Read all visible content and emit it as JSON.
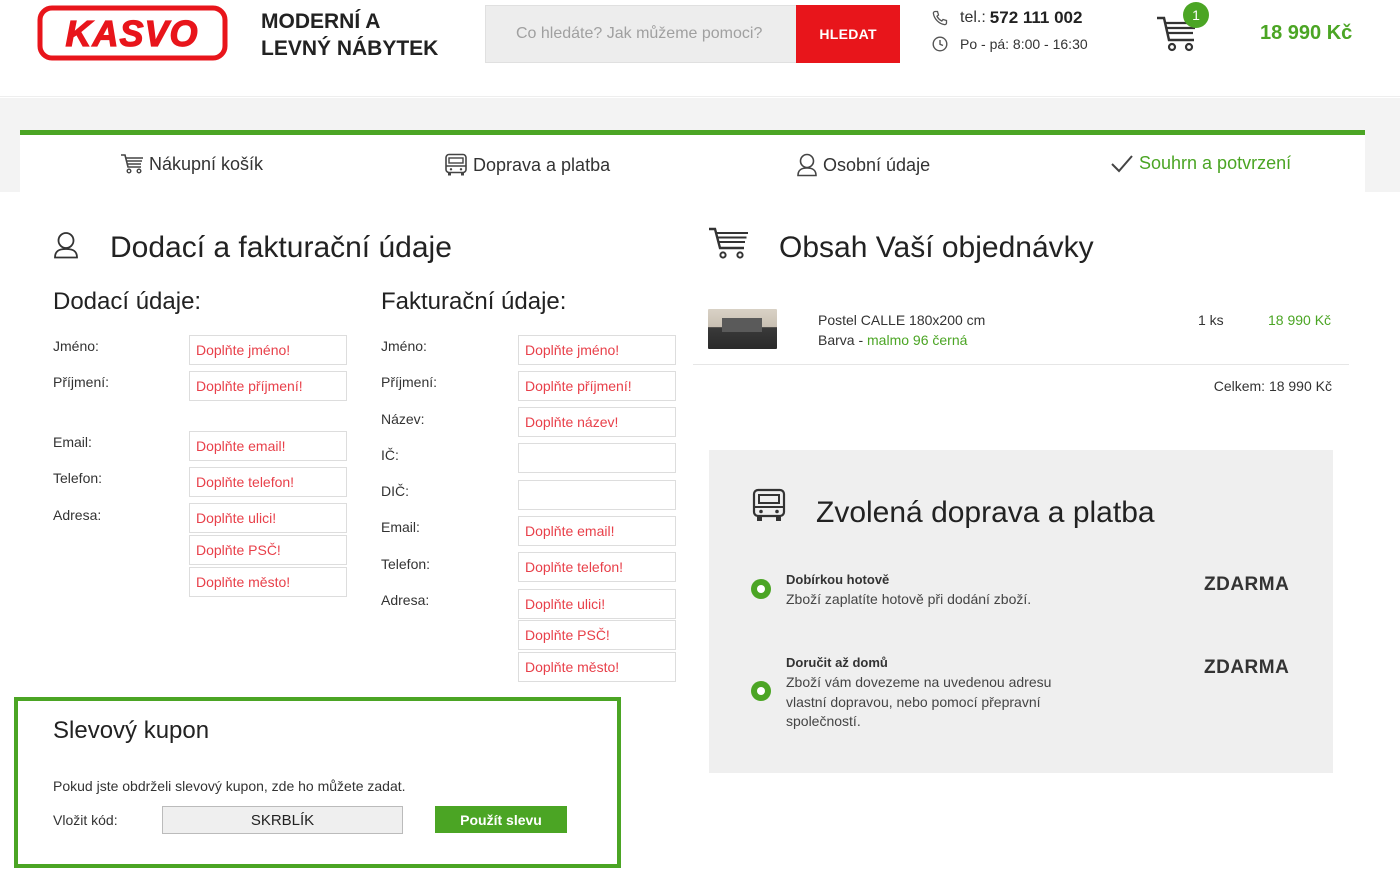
{
  "header": {
    "logo_text": "KASVO",
    "tagline_line1": "MODERNÍ A",
    "tagline_line2": "LEVNÝ NÁBYTEK",
    "search_placeholder": "Co hledáte? Jak můžeme pomoci?",
    "search_button": "HLEDAT",
    "phone_label": "tel.:",
    "phone_number": "572 111 002",
    "hours": "Po - pá: 8:00 - 16:30",
    "cart_count": "1",
    "cart_total": "18 990 Kč"
  },
  "steps": [
    {
      "label": "Nákupní košík",
      "icon": "cart-icon",
      "active": false
    },
    {
      "label": "Doprava a platba",
      "icon": "truck-icon",
      "active": false
    },
    {
      "label": "Osobní údaje",
      "icon": "user-icon",
      "active": false
    },
    {
      "label": "Souhrn a potvrzení",
      "icon": "check-icon",
      "active": true
    }
  ],
  "left_section": {
    "title": "Dodací a fakturační údaje",
    "delivery": {
      "title": "Dodací údaje:",
      "labels": {
        "name": "Jméno:",
        "surname": "Příjmení:",
        "email": "Email:",
        "phone": "Telefon:",
        "address": "Adresa:"
      },
      "placeholders": {
        "name": "Doplňte jméno!",
        "surname": "Doplňte příjmení!",
        "email": "Doplňte email!",
        "phone": "Doplňte telefon!",
        "street": "Doplňte ulici!",
        "zip": "Doplňte PSČ!",
        "city": "Doplňte město!"
      }
    },
    "billing": {
      "title": "Fakturační údaje:",
      "labels": {
        "name": "Jméno:",
        "surname": "Příjmení:",
        "company": "Název:",
        "ico": "IČ:",
        "dic": "DIČ:",
        "email": "Email:",
        "phone": "Telefon:",
        "address": "Adresa:"
      },
      "placeholders": {
        "name": "Doplňte jméno!",
        "surname": "Doplňte příjmení!",
        "company": "Doplňte název!",
        "ico": "",
        "dic": "",
        "email": "Doplňte email!",
        "phone": "Doplňte telefon!",
        "street": "Doplňte ulici!",
        "zip": "Doplňte PSČ!",
        "city": "Doplňte město!"
      }
    }
  },
  "order": {
    "title": "Obsah Vaší objednávky",
    "item": {
      "name": "Postel CALLE 180x200 cm",
      "variant_label": "Barva - ",
      "variant_value": "malmo 96 černá",
      "quantity": "1 ks",
      "price": "18 990 Kč"
    },
    "total": "Celkem: 18 990 Kč"
  },
  "shipping": {
    "title": "Zvolená doprava a platba",
    "options": [
      {
        "title": "Dobírkou hotově",
        "desc": "Zboží zaplatíte hotově při dodání zboží.",
        "price": "ZDARMA"
      },
      {
        "title": "Doručit až domů",
        "desc": "Zboží vám dovezeme na uvedenou adresu vlastní dopravou, nebo pomocí přepravní společností.",
        "price": "ZDARMA"
      }
    ]
  },
  "coupon": {
    "title": "Slevový kupon",
    "text": "Pokud jste obdrželi slevový kupon, zde ho můžete zadat.",
    "label": "Vložit kód:",
    "value": "SKRBLÍK",
    "button": "Použít slevu"
  },
  "colors": {
    "accent": "#4ba524",
    "brand_red": "#e8151b"
  }
}
